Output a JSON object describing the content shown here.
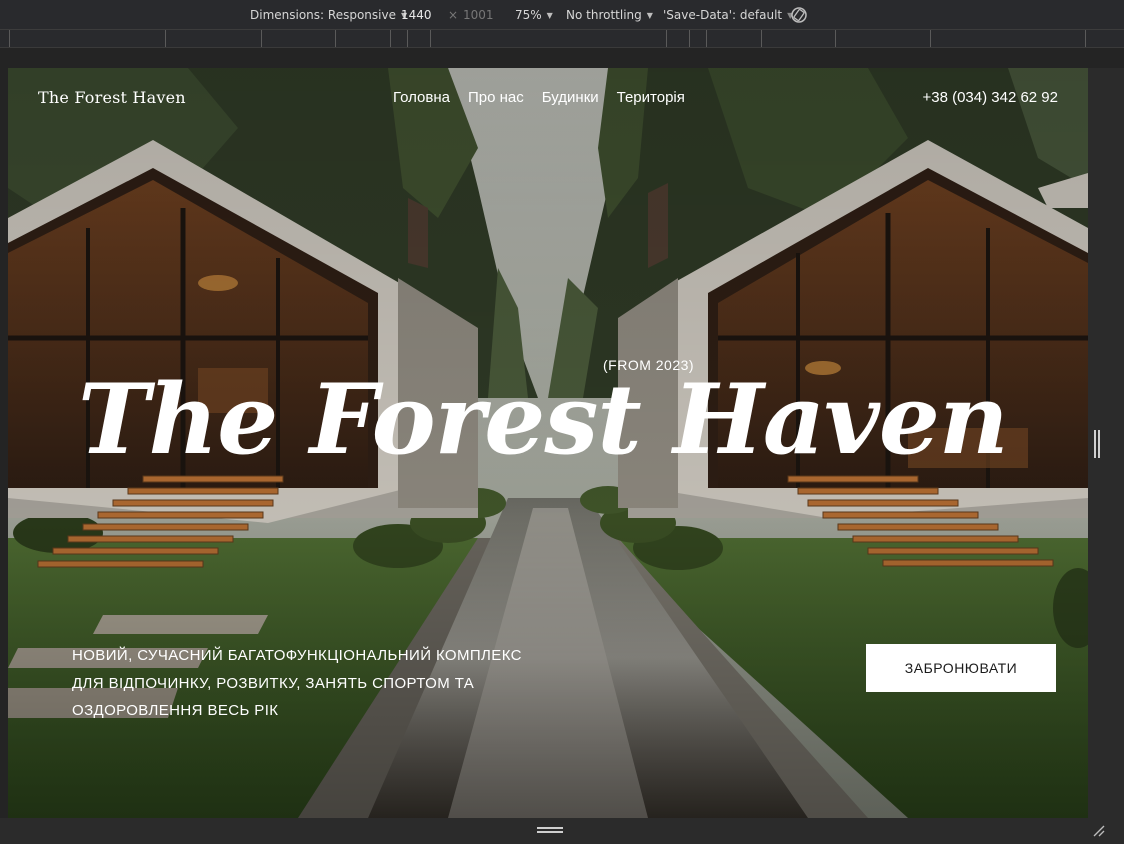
{
  "devtools": {
    "dimensions_label": "Dimensions: Responsive",
    "width_value": "1440",
    "times_symbol": "×",
    "height_value": "1001",
    "zoom": "75%",
    "throttling": "No throttling",
    "save_data": "'Save-Data': default"
  },
  "site": {
    "logo": "The Forest Haven",
    "nav": [
      "Головна",
      "Про нас",
      "Будинки",
      "Територія"
    ],
    "phone": "+38 (034) 342 62 92",
    "from_year": "(FROM 2023)",
    "hero_title": "The Forest Haven",
    "tagline": "НОВИЙ, СУЧАСНИЙ БАГАТОФУНКЦІОНАЛЬНИЙ КОМПЛЕКС ДЛЯ ВІДПОЧИНКУ, РОЗВИТКУ, ЗАНЯТЬ СПОРТОМ ТА ОЗДОРОВЛЕННЯ ВЕСЬ РІК",
    "book_button": "ЗАБРОНЮВАТИ"
  },
  "colors": {
    "devtools_bg": "#292a2d",
    "button_bg": "#ffffff",
    "text_light": "#ffffff"
  }
}
